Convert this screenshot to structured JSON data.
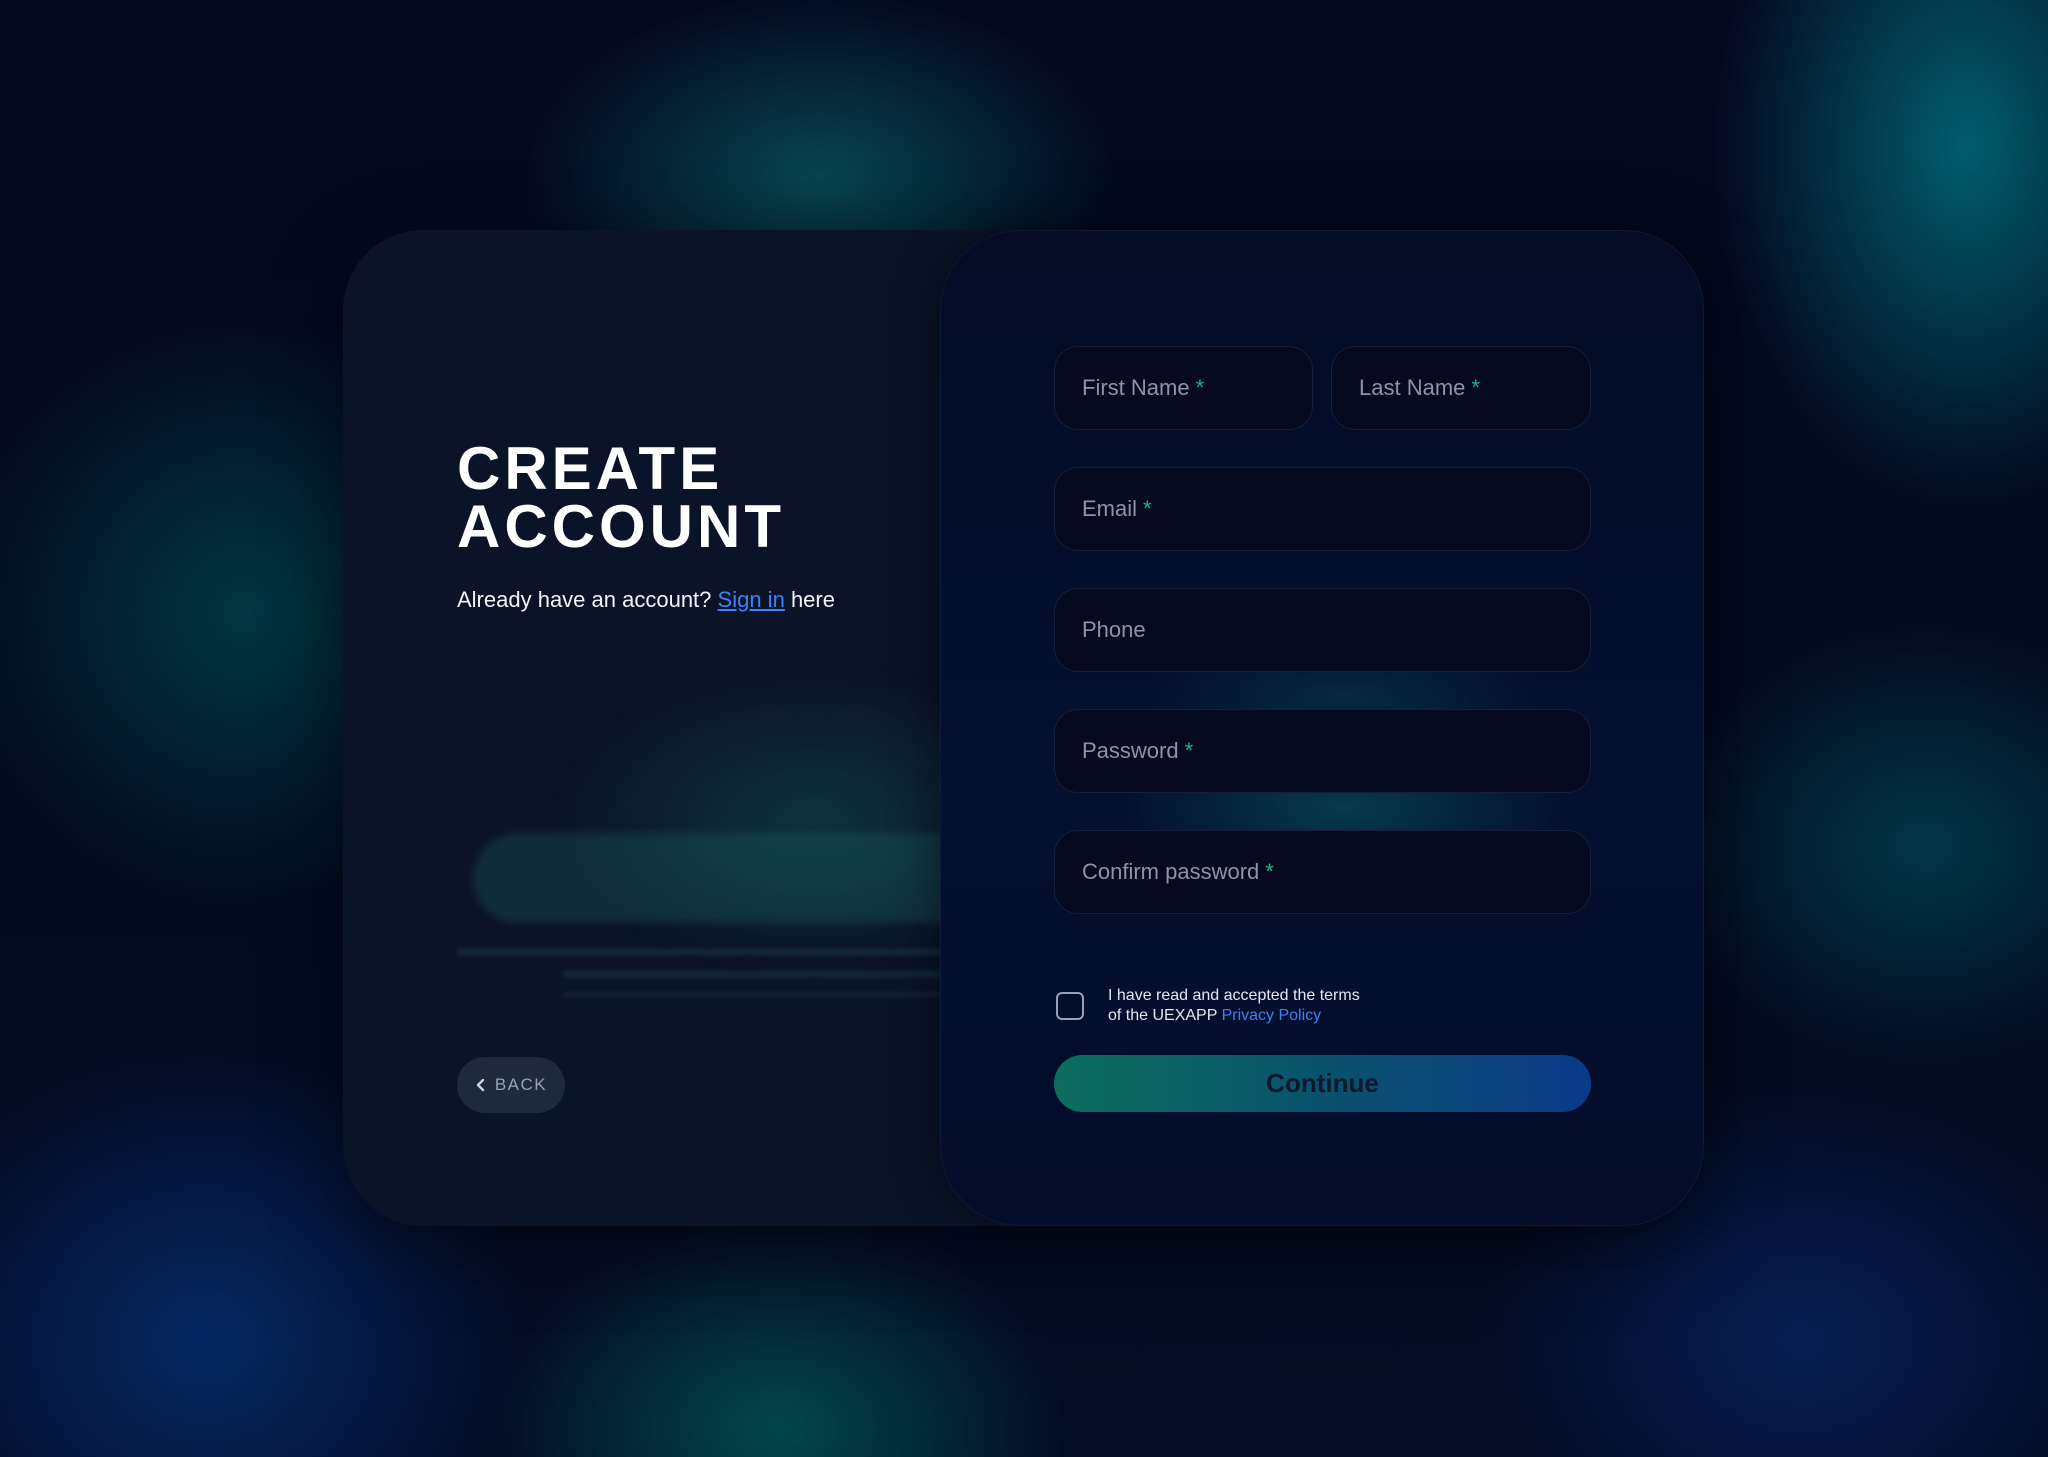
{
  "header": {
    "title_line1": "CREATE",
    "title_line2": "ACCOUNT",
    "subtitle_prefix": "Already have an account?",
    "signin_label": "Sign in",
    "subtitle_suffix": "here"
  },
  "back_button": {
    "label": "BACK",
    "icon": "chevron-left-icon"
  },
  "form": {
    "first_name": {
      "label": "First Name",
      "required": "*"
    },
    "last_name": {
      "label": "Last Name",
      "required": "*"
    },
    "email": {
      "label": "Email",
      "required": "*"
    },
    "phone": {
      "label": "Phone"
    },
    "password": {
      "label": "Password",
      "required": "*"
    },
    "confirm_password": {
      "label": "Confirm password",
      "required": "*"
    },
    "terms": {
      "line1": "I have read and accepted the terms",
      "line2_prefix": "of the UEXAPP",
      "link": "Privacy Policy",
      "checked": false
    },
    "continue_label": "Continue"
  },
  "colors": {
    "accent_green": "#10b981",
    "link_blue": "#3b82f6",
    "card_left": "#0b1328",
    "card_right": "#040c26"
  }
}
